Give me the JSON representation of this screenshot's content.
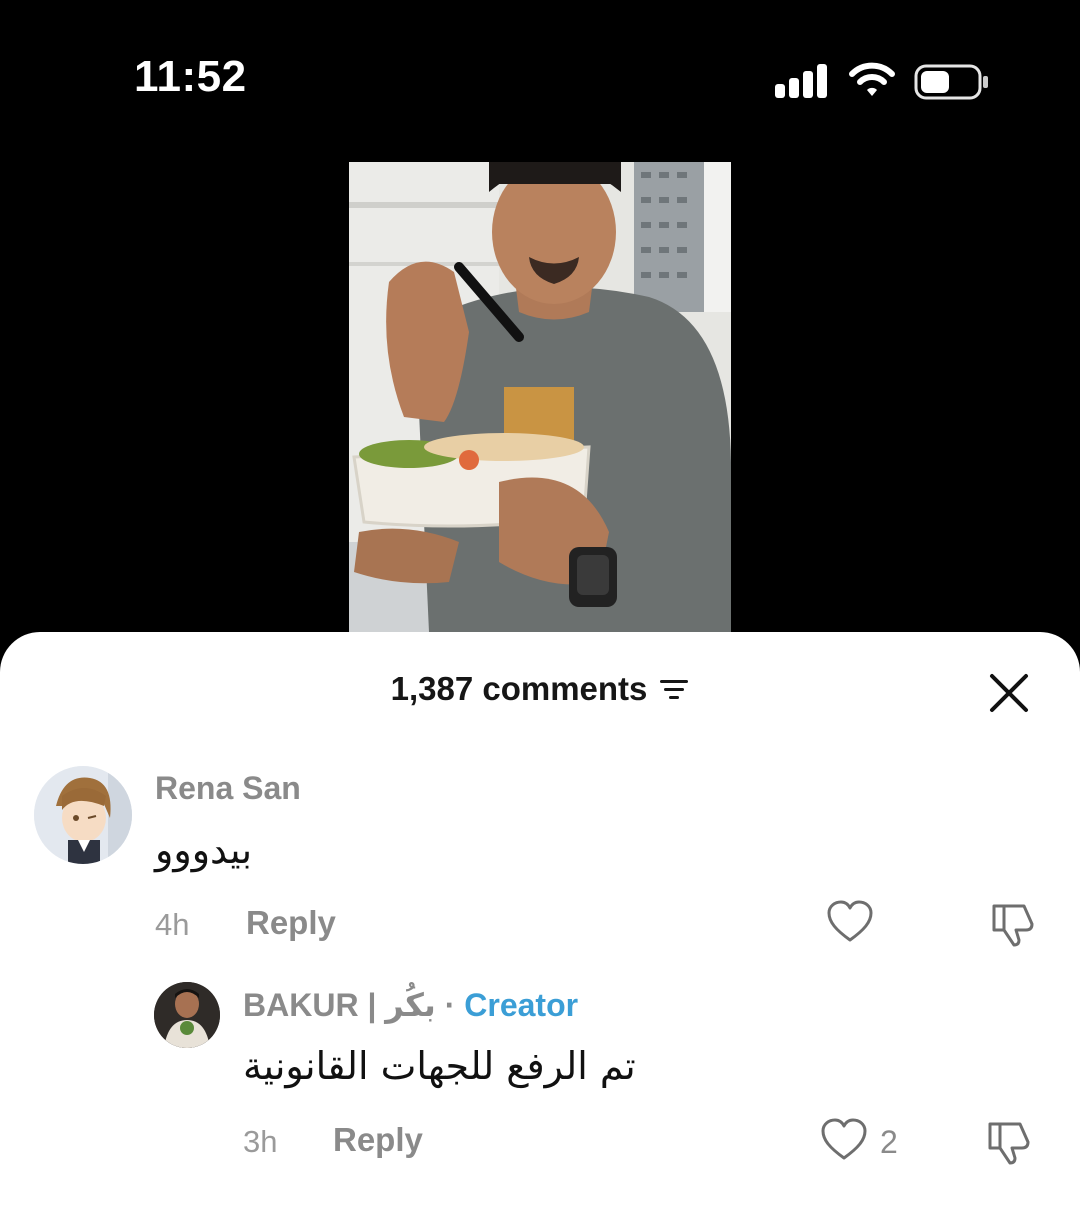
{
  "status_bar": {
    "time": "11:52"
  },
  "comments_sheet": {
    "count_label": "1,387 comments",
    "comments": [
      {
        "author": "Rena San",
        "text": "بيدووو",
        "time": "4h",
        "reply_label": "Reply"
      },
      {
        "author": "BAKUR | بكُر",
        "badge": "Creator",
        "separator": "·",
        "text": "تم الرفع للجهات القانونية",
        "time": "3h",
        "reply_label": "Reply",
        "like_count": "2"
      }
    ]
  }
}
